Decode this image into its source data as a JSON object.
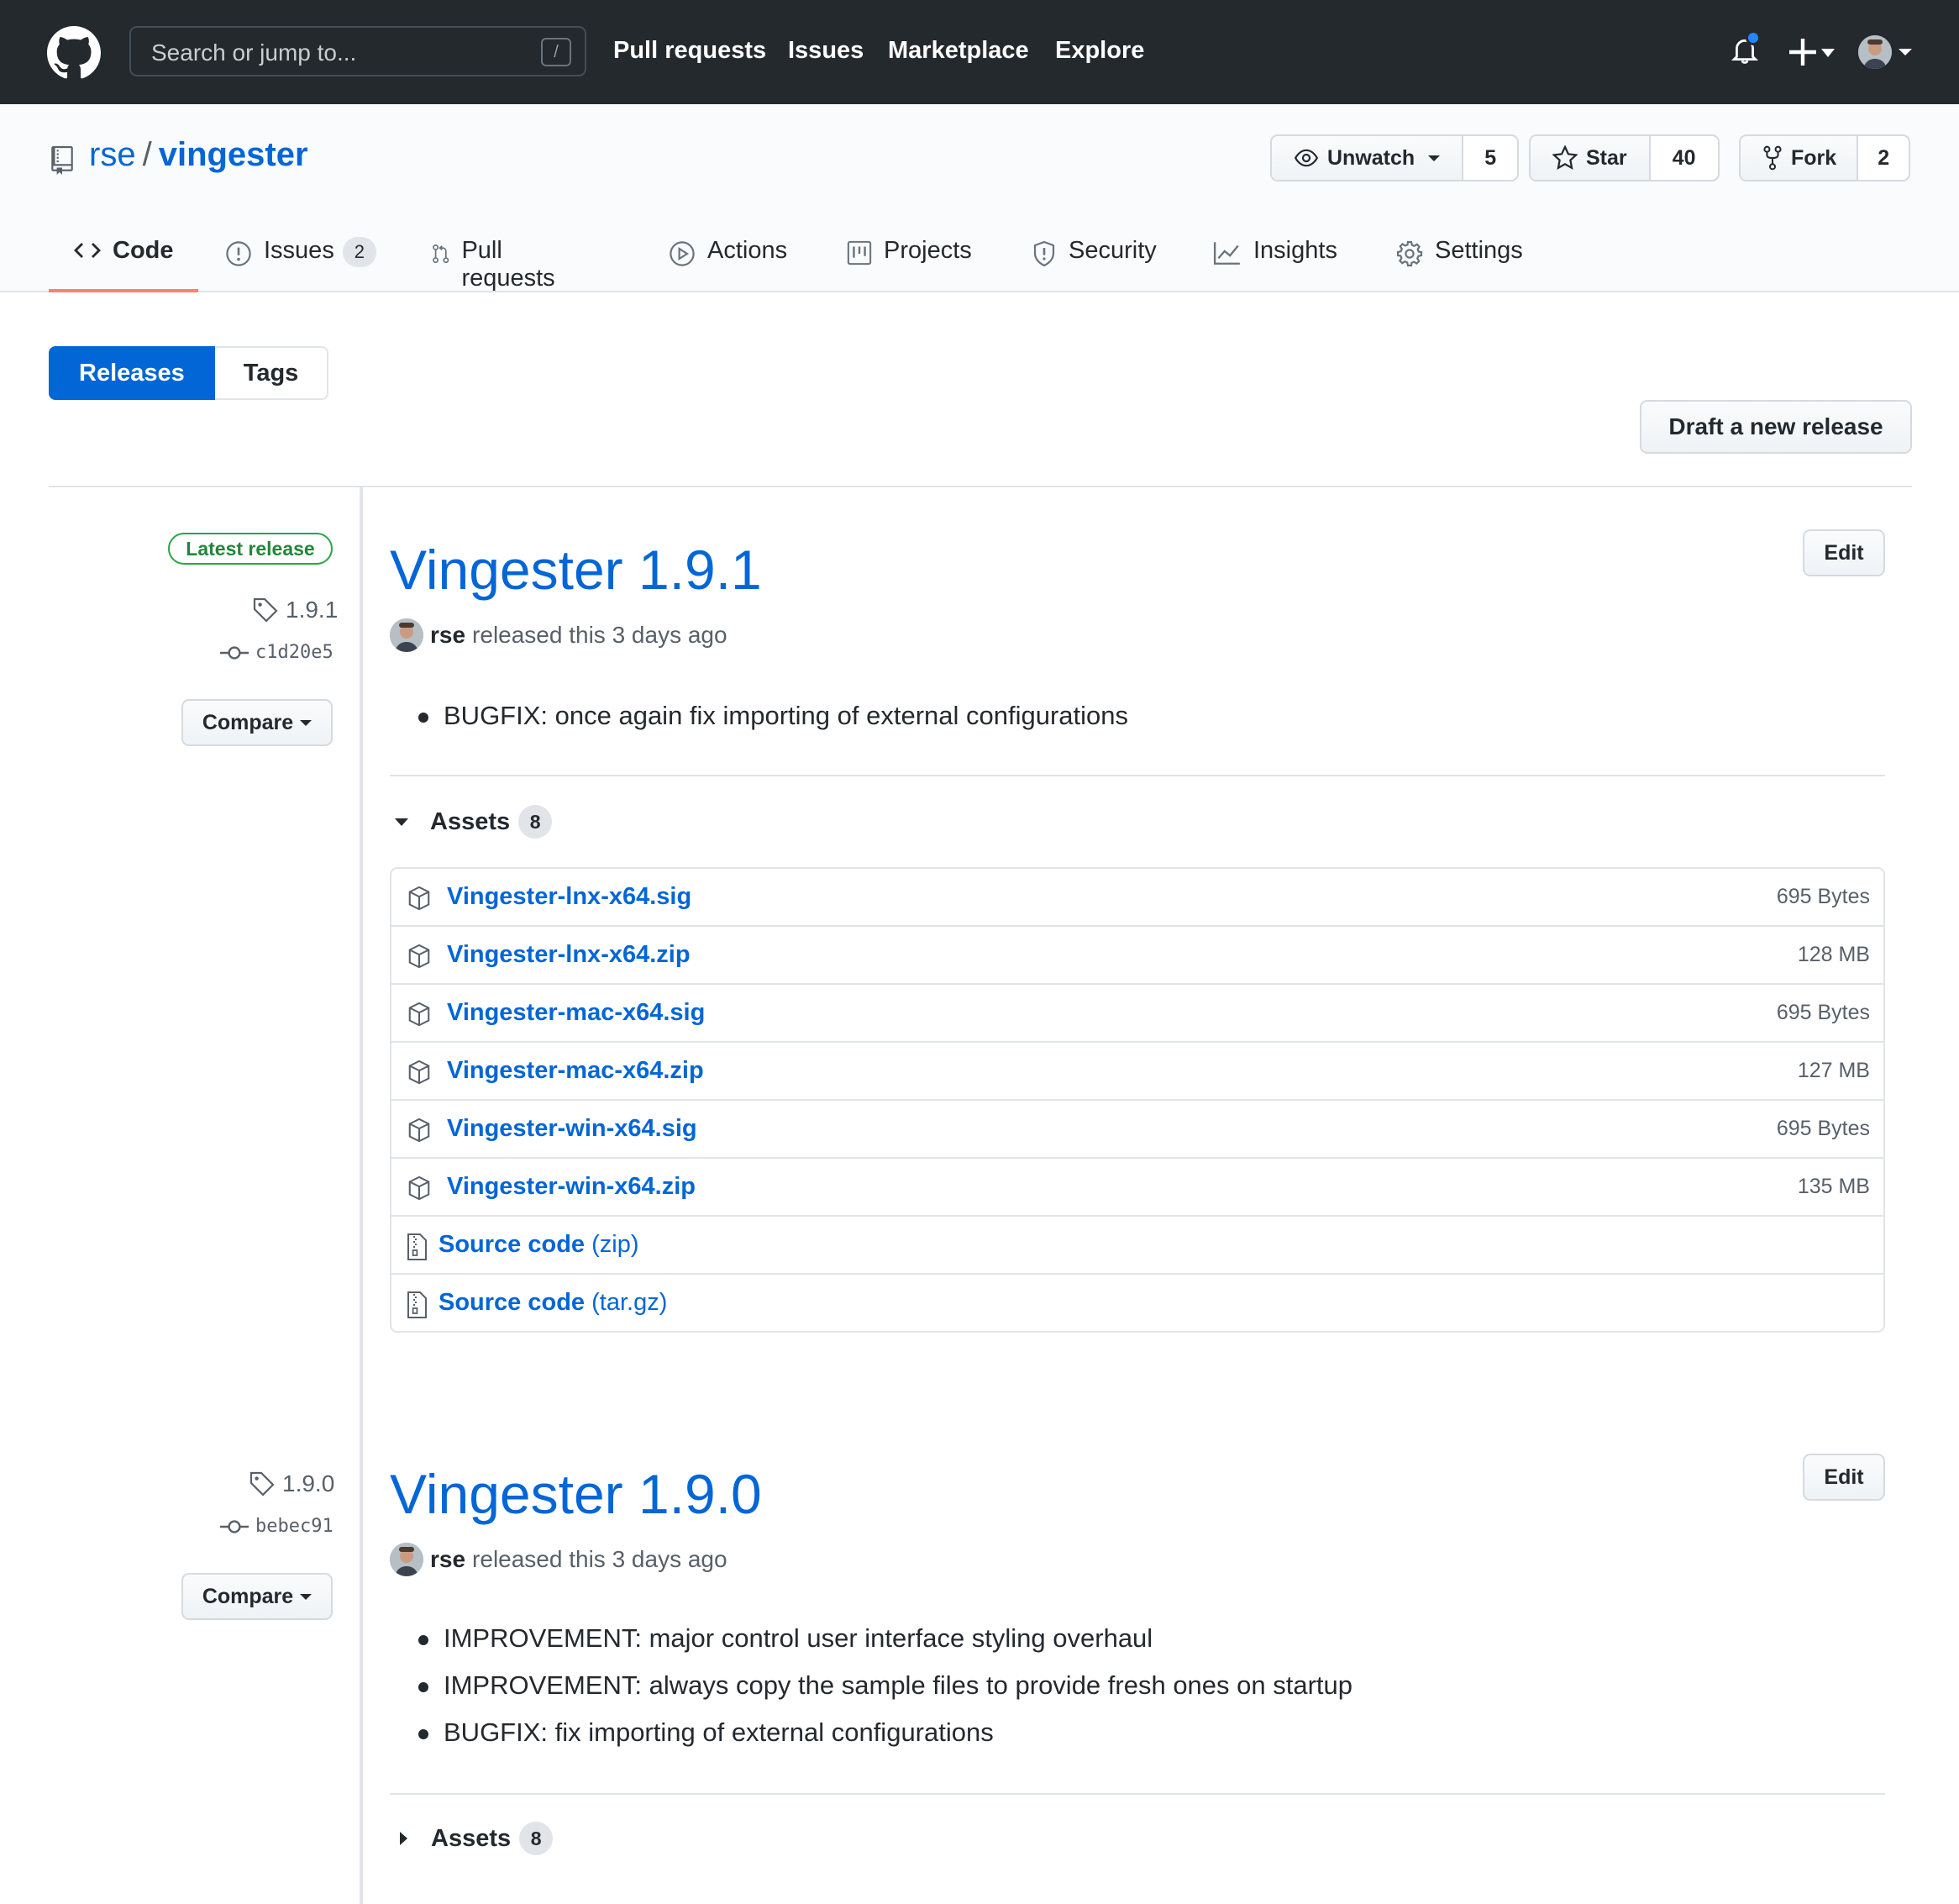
{
  "header": {
    "search_placeholder": "Search or jump to...",
    "search_shortcut": "/",
    "nav": [
      "Pull requests",
      "Issues",
      "Marketplace",
      "Explore"
    ]
  },
  "repo": {
    "owner": "rse",
    "separator": "/",
    "name": "vingester",
    "watch_label": "Unwatch",
    "watch_count": "5",
    "star_label": "Star",
    "star_count": "40",
    "fork_label": "Fork",
    "fork_count": "2"
  },
  "tabs": {
    "code": "Code",
    "issues": "Issues",
    "issues_count": "2",
    "pulls": "Pull requests",
    "actions": "Actions",
    "projects": "Projects",
    "security": "Security",
    "insights": "Insights",
    "settings": "Settings"
  },
  "subnav": {
    "releases": "Releases",
    "tags": "Tags",
    "draft": "Draft a new release"
  },
  "releases": [
    {
      "latest_label": "Latest release",
      "tag": "1.9.1",
      "commit": "c1d20e5",
      "compare": "Compare",
      "title": "Vingester 1.9.1",
      "edit": "Edit",
      "author": "rse",
      "released_text": "released this 3 days ago",
      "notes": [
        "BUGFIX: once again fix importing of external configurations"
      ],
      "assets_label": "Assets",
      "assets_count": "8",
      "assets_expanded": true,
      "assets": [
        {
          "name": "Vingester-lnx-x64.sig",
          "size": "695 Bytes"
        },
        {
          "name": "Vingester-lnx-x64.zip",
          "size": "128 MB"
        },
        {
          "name": "Vingester-mac-x64.sig",
          "size": "695 Bytes"
        },
        {
          "name": "Vingester-mac-x64.zip",
          "size": "127 MB"
        },
        {
          "name": "Vingester-win-x64.sig",
          "size": "695 Bytes"
        },
        {
          "name": "Vingester-win-x64.zip",
          "size": "135 MB"
        }
      ],
      "source": [
        {
          "label": "Source code",
          "fmt": "(zip)"
        },
        {
          "label": "Source code",
          "fmt": "(tar.gz)"
        }
      ]
    },
    {
      "tag": "1.9.0",
      "commit": "bebec91",
      "compare": "Compare",
      "title": "Vingester 1.9.0",
      "edit": "Edit",
      "author": "rse",
      "released_text": "released this 3 days ago",
      "notes": [
        "IMPROVEMENT: major control user interface styling overhaul",
        "IMPROVEMENT: always copy the sample files to provide fresh ones on startup",
        "BUGFIX: fix importing of external configurations"
      ],
      "assets_label": "Assets",
      "assets_count": "8",
      "assets_expanded": false
    }
  ],
  "colors": {
    "header_bg": "#24292e",
    "link": "#0366d6",
    "tab_underline": "#f9826c",
    "latest_green": "#28a745",
    "notification_dot": "#2188ff"
  },
  "icons": [
    "github-logo-icon",
    "bell-icon",
    "plus-icon",
    "repo-icon",
    "eye-icon",
    "star-icon",
    "fork-icon",
    "code-icon",
    "issue-icon",
    "pull-request-icon",
    "play-icon",
    "project-icon",
    "shield-icon",
    "graph-icon",
    "gear-icon",
    "tag-icon",
    "commit-icon",
    "package-icon",
    "file-zip-icon"
  ]
}
